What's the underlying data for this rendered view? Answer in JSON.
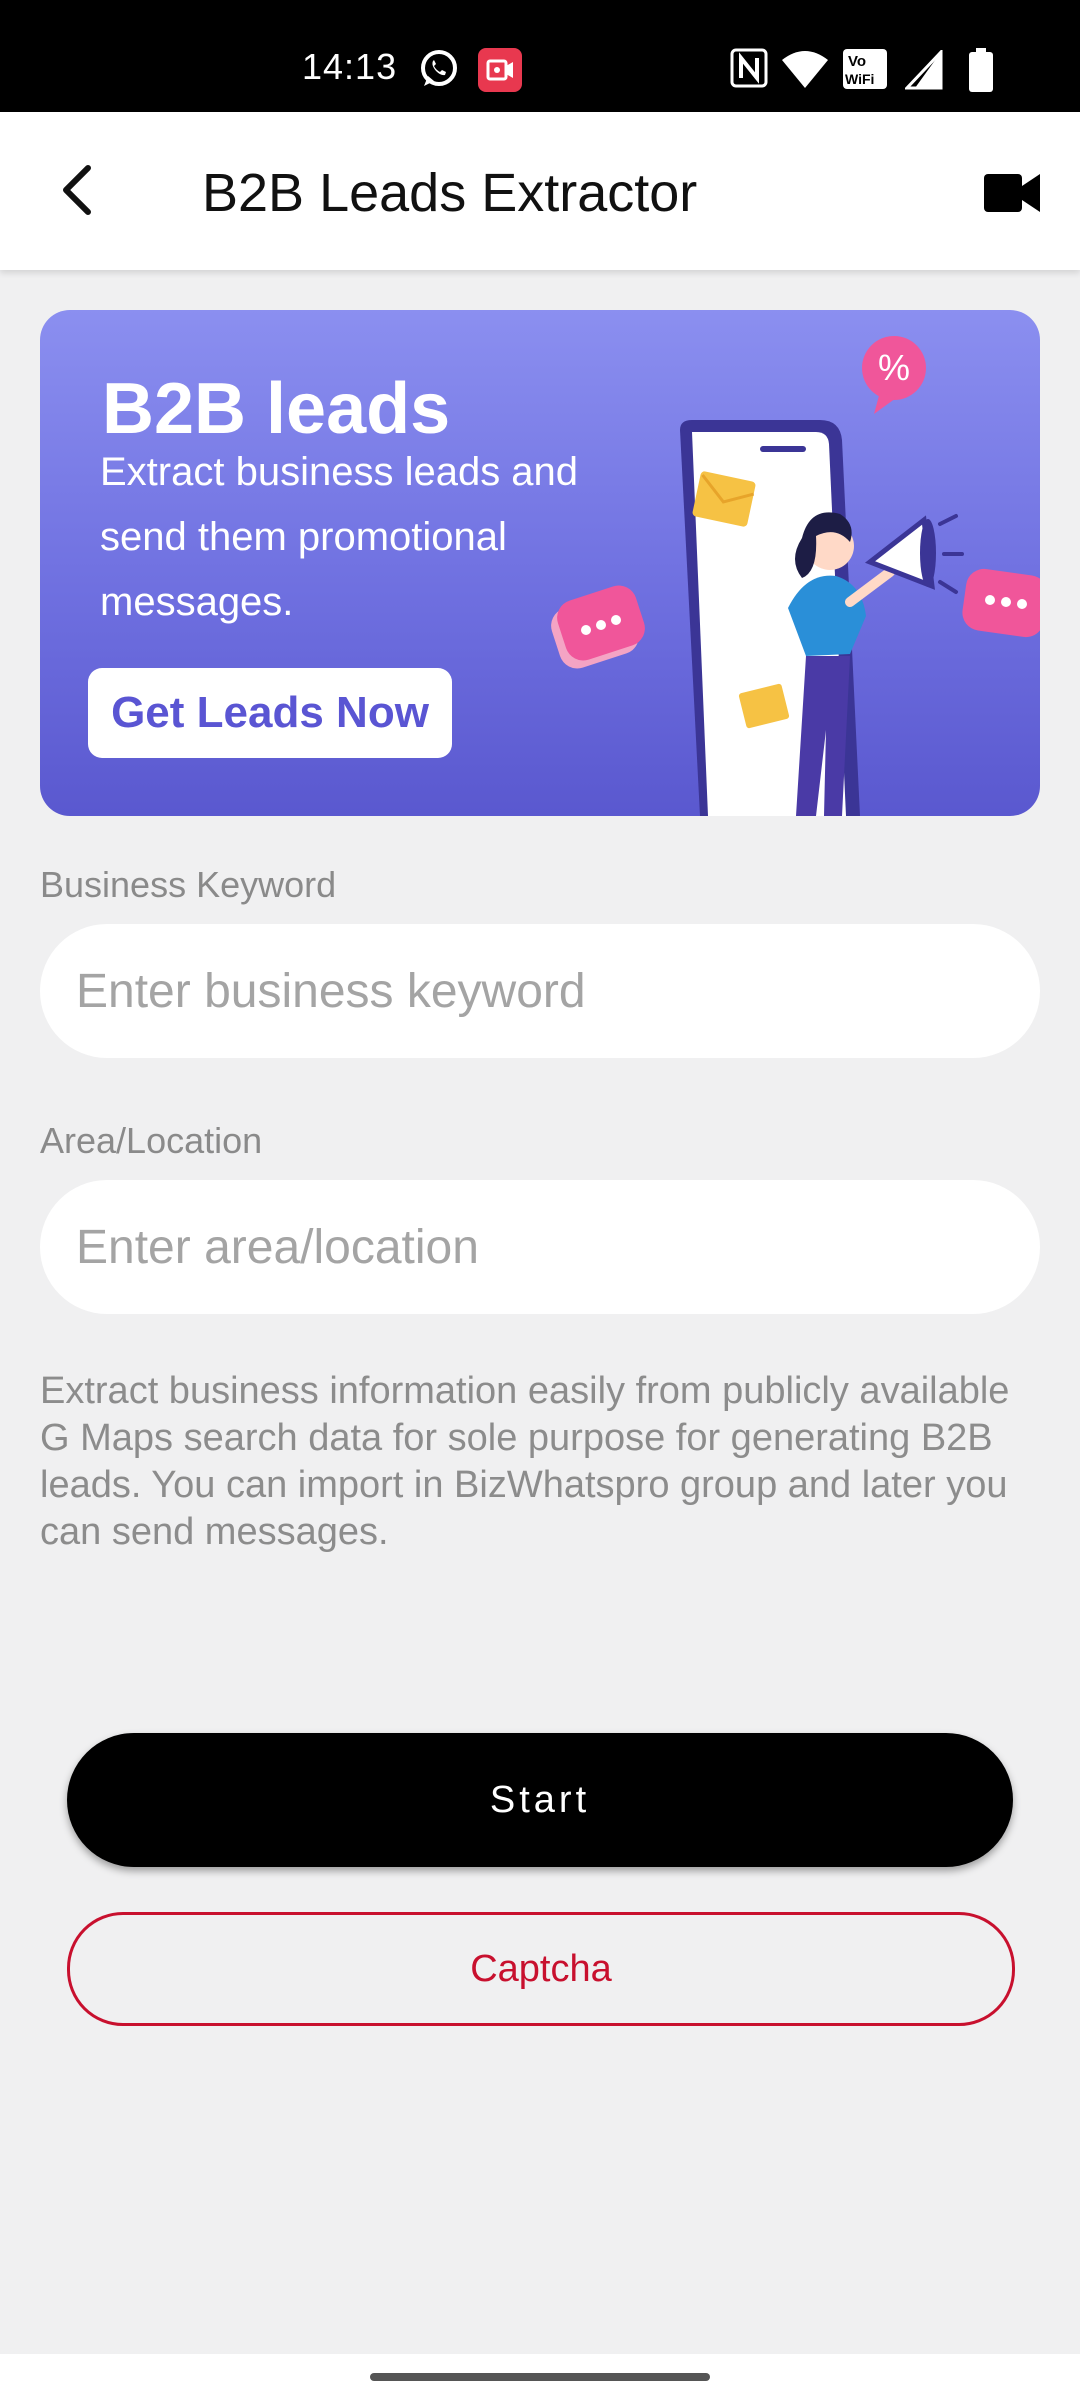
{
  "status_bar": {
    "time": "14:13",
    "left_icons": [
      "whatsapp-icon",
      "screen-recorder-icon"
    ],
    "right_icons": [
      "nfc-icon",
      "wifi-icon",
      "vowifi-icon",
      "cell-signal-icon",
      "battery-icon"
    ],
    "vowifi_label_top": "Vo",
    "vowifi_label_bottom": "WiFi"
  },
  "app_bar": {
    "title": "B2B Leads Extractor",
    "back_icon": "arrow-back-icon",
    "action_icon": "video-camera-icon"
  },
  "banner": {
    "title": "B2B leads",
    "subtitle": "Extract business leads and send them promotional messages.",
    "cta": "Get Leads Now",
    "badge_symbol": "%",
    "colors": {
      "gradient_top": "#8b8ff0",
      "gradient_bottom": "#5a58cf",
      "cta_text": "#5a55d3",
      "accent_pink": "#f0569a"
    }
  },
  "form": {
    "keyword": {
      "label": "Business Keyword",
      "placeholder": "Enter business keyword",
      "value": ""
    },
    "location": {
      "label": "Area/Location",
      "placeholder": "Enter area/location",
      "value": ""
    }
  },
  "description": "Extract business information easily from publicly available G Maps search data for sole purpose for generating B2B leads. You can import in BizWhatspro group and later you can send messages.",
  "buttons": {
    "start": "Start",
    "captcha": "Captcha"
  },
  "colors": {
    "background": "#f0f0f1",
    "start_button": "#000000",
    "captcha_accent": "#c8102e"
  }
}
